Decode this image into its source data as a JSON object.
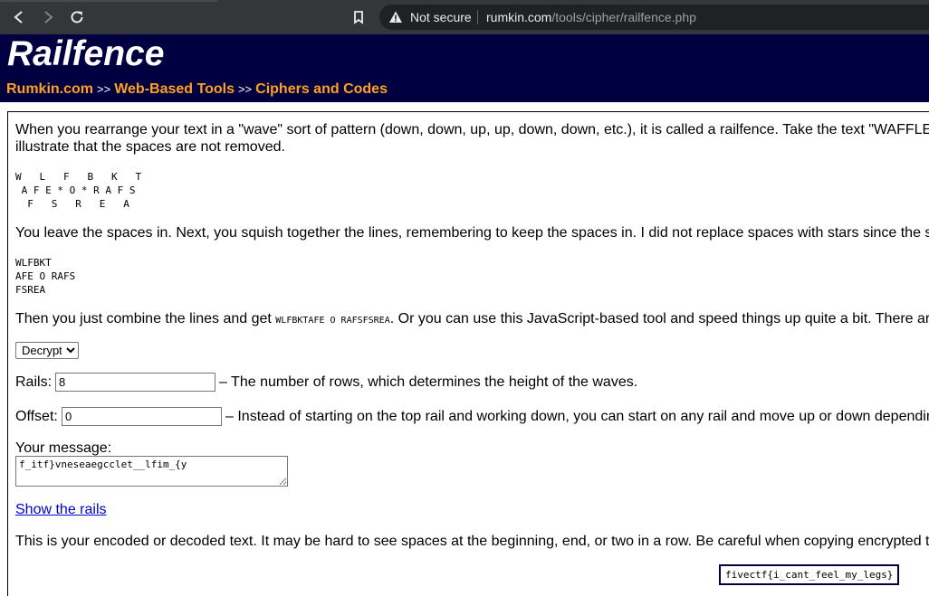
{
  "browser": {
    "security_label": "Not secure",
    "url_domain": "rumkin.com",
    "url_path": "/tools/cipher/railfence.php"
  },
  "header": {
    "title": "Railfence",
    "breadcrumbs": [
      "Rumkin.com",
      "Web-Based Tools",
      "Ciphers and Codes"
    ],
    "separator": ">>"
  },
  "intro": {
    "line1": "When you rearrange your text in a \"wave\" sort of pattern (down, down, up, up, down, down, etc.), it is called a railfence. Take the text \"WAFFLES FOR",
    "line2": "illustrate that the spaces are not removed."
  },
  "example_wave": [
    "W   L   F   B   K   T",
    " A F E * O * R A F S",
    "  F   S   R   E   A"
  ],
  "para2": "You leave the spaces in. Next, you squish together the lines, remembering to keep the spaces in. I did not replace spaces with stars since the spa",
  "example_lines": [
    "WLFBKT",
    "AFE O RAFS",
    "FSREA"
  ],
  "para3": {
    "before": "Then you just combine the lines and get ",
    "code": "WLFBKTAFE O RAFSFSREA",
    "after": ". Or you can use this JavaScript-based tool and speed things up quite a bit. There are"
  },
  "form": {
    "mode_selected": "Decrypt",
    "rails_label": "Rails:",
    "rails_value": "8",
    "rails_help": "– The number of rows, which determines the height of the waves.",
    "offset_label": "Offset:",
    "offset_value": "0",
    "offset_help": "– Instead of starting on the top rail and working down, you can start on any rail and move up or down depending",
    "message_label": "Your message:",
    "message_value": "f_itf}vneseaegcclet__lfim_{y",
    "show_rails_link": "Show the rails"
  },
  "result": {
    "description": "This is your encoded or decoded text. It may be hard to see spaces at the beginning, end, or two in a row. Be careful when copying encrypted te",
    "output": "fivectf{i_cant_feel_my_legs}"
  },
  "colors": {
    "header_bg": "#000040",
    "breadcrumb": "#ffa020",
    "chrome_bg": "#35363a"
  }
}
